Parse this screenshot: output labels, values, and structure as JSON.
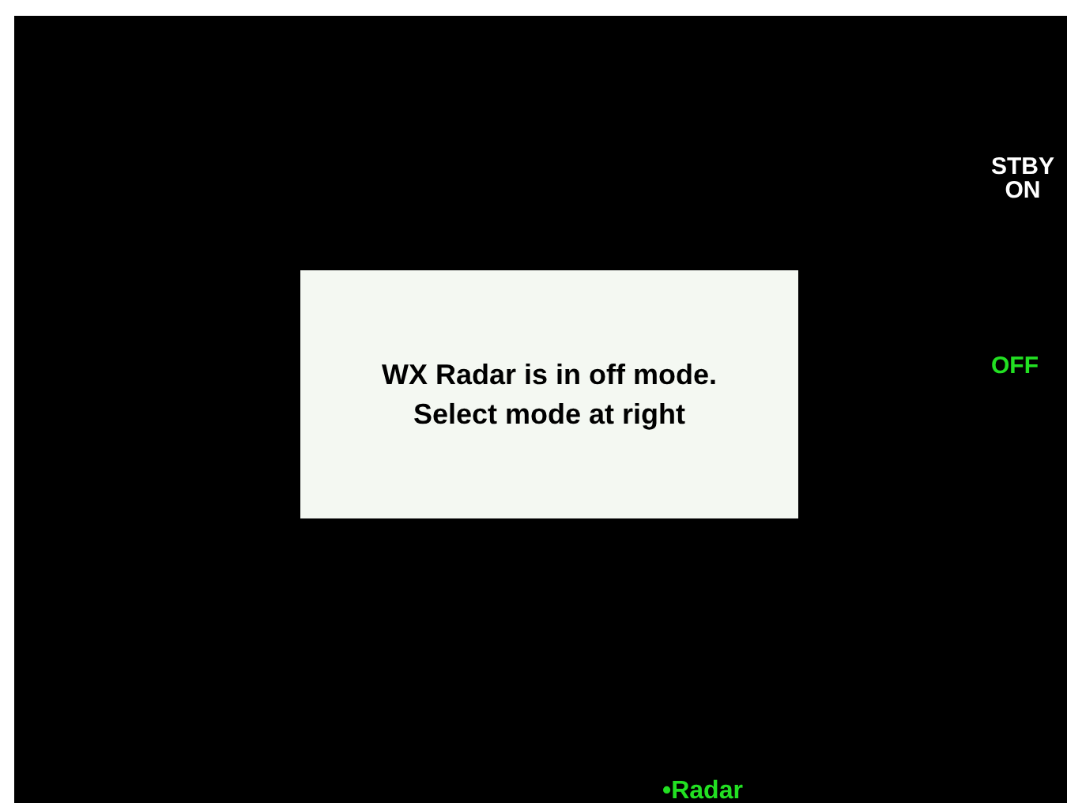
{
  "message": {
    "lines": [
      "WX Radar is in off mode.",
      "Select mode at right"
    ]
  },
  "mode_keys": [
    {
      "lines": [
        "STBY",
        "ON"
      ],
      "selected": false
    },
    {
      "lines": [
        "OFF"
      ],
      "selected": true
    }
  ],
  "page_label": {
    "text": "•Radar",
    "selected": true
  }
}
